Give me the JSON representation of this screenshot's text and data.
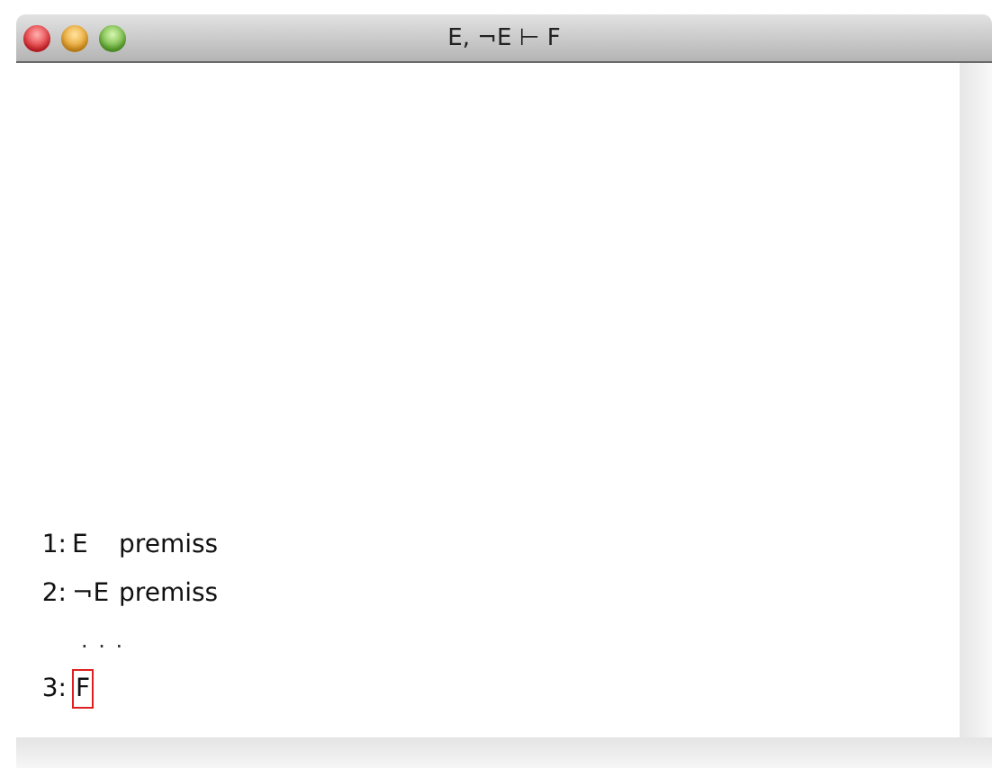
{
  "window": {
    "title": "E, ¬E ⊢ F"
  },
  "proof": [
    {
      "kind": "step",
      "number": "1:",
      "formula": "E",
      "justification": "premiss"
    },
    {
      "kind": "step",
      "number": "2:",
      "formula": "¬E",
      "justification": "premiss"
    },
    {
      "kind": "gap",
      "text": ". . ."
    },
    {
      "kind": "goal",
      "number": "3:",
      "formula": "F"
    }
  ]
}
